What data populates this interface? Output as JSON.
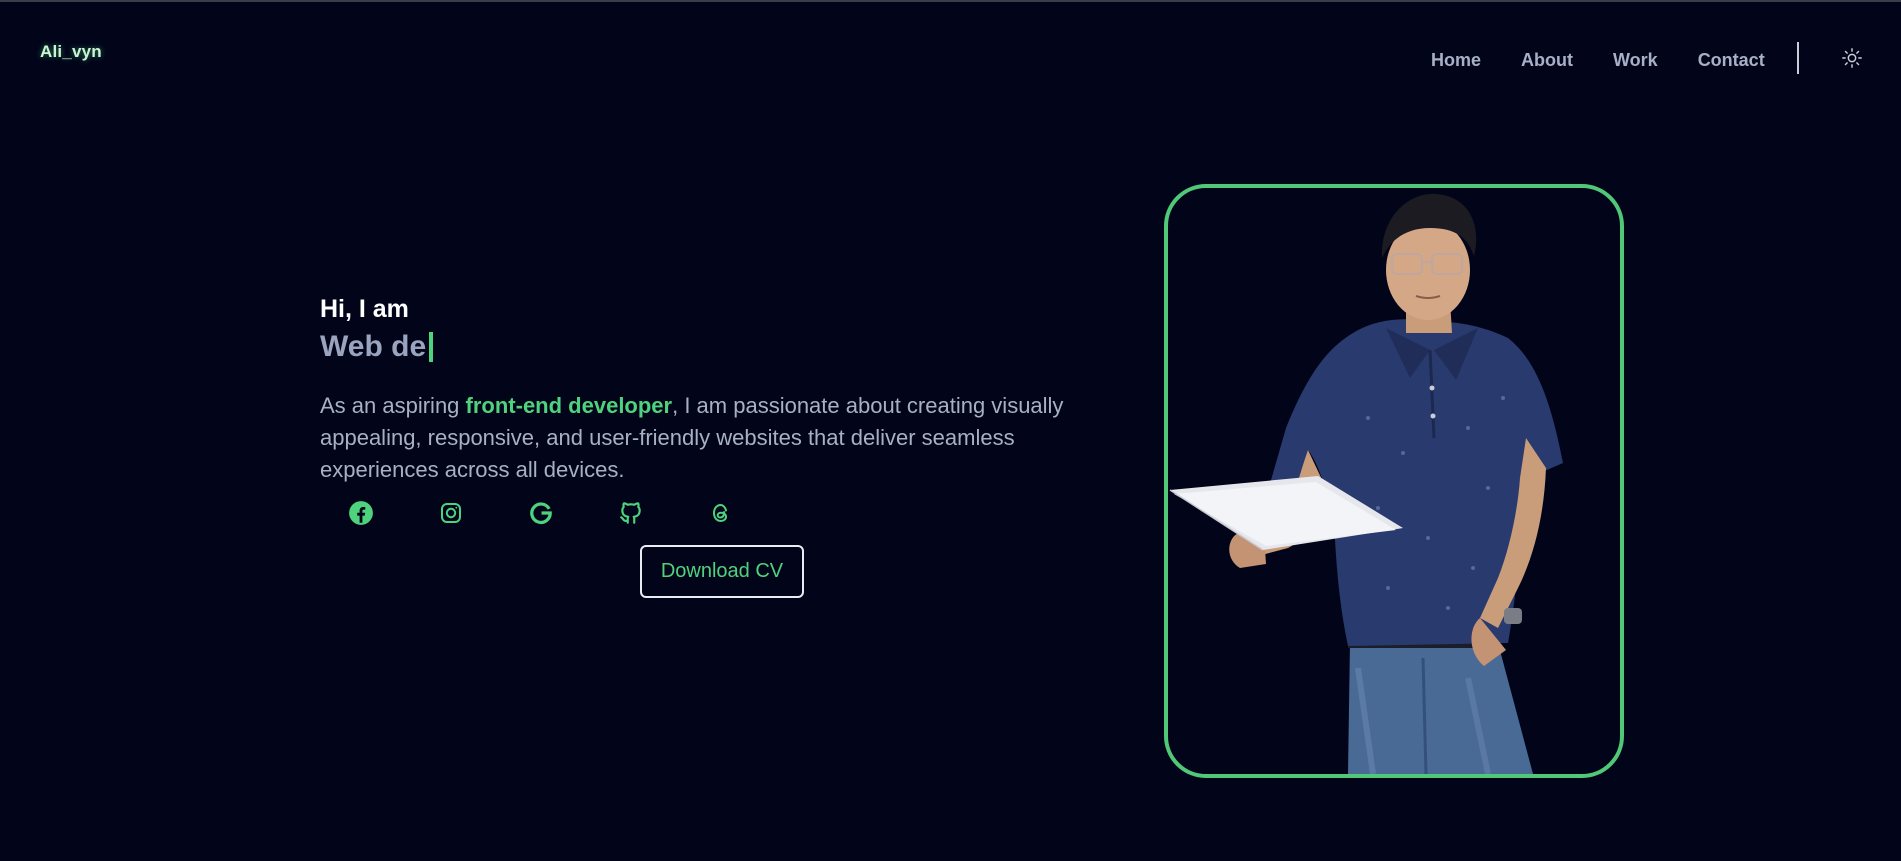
{
  "brand": {
    "logo": "Ali_vyn"
  },
  "nav": {
    "items": [
      {
        "label": "Home"
      },
      {
        "label": "About"
      },
      {
        "label": "Work"
      },
      {
        "label": "Contact"
      }
    ],
    "theme_icon": "sun-icon"
  },
  "hero": {
    "greeting": "Hi, I am",
    "role_typed": "Web de",
    "bio_prefix": "As an aspiring ",
    "bio_highlight": "front-end developer",
    "bio_suffix": ", I am passionate about creating visually appealing, responsive, and user-friendly websites that deliver seamless experiences across all devices.",
    "socials": [
      {
        "icon": "facebook-icon"
      },
      {
        "icon": "instagram-icon"
      },
      {
        "icon": "google-icon"
      },
      {
        "icon": "github-icon"
      },
      {
        "icon": "threads-icon"
      }
    ],
    "cv_button": "Download CV"
  },
  "colors": {
    "background": "#02051a",
    "accent": "#4fd27d",
    "frame": "#50c878",
    "text_muted": "#a8b0c5",
    "nav_text": "#a7b0c7"
  }
}
